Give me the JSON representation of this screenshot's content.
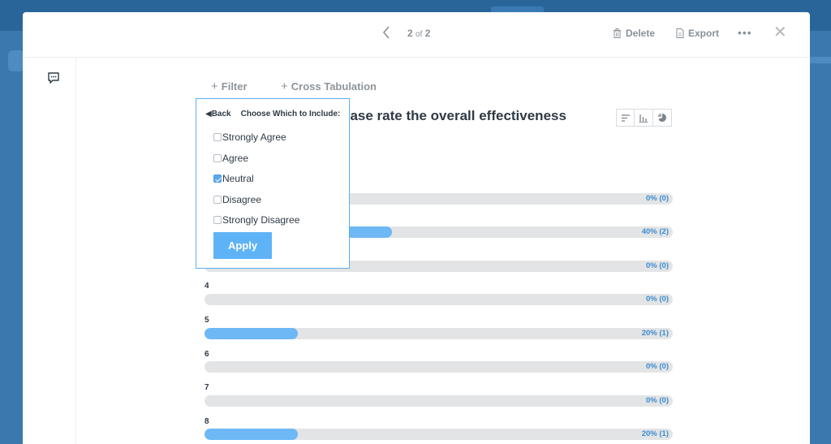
{
  "header": {
    "prev_icon": "chevron-left-icon",
    "pager_current": "2",
    "pager_of": "of",
    "pager_total": "2",
    "delete_label": "Delete",
    "export_label": "Export",
    "more_label": "•••",
    "close_label": "✕"
  },
  "toolbar": {
    "filter_label": "Filter",
    "cross_tab_label": "Cross Tabulation"
  },
  "question": {
    "title_visible_fragment": "ease rate the overall effectiveness"
  },
  "filter_panel": {
    "back_label": "◀Back",
    "heading": "Choose Which to Include:",
    "options": [
      {
        "label": "Strongly Agree",
        "checked": false
      },
      {
        "label": "Agree",
        "checked": false
      },
      {
        "label": "Neutral",
        "checked": true
      },
      {
        "label": "Disagree",
        "checked": false
      },
      {
        "label": "Strongly Disagree",
        "checked": false
      }
    ],
    "apply_label": "Apply"
  },
  "results": [
    {
      "label": "",
      "value_text": "0% (0)",
      "percent": 0
    },
    {
      "label": "",
      "value_text": "40% (2)",
      "percent": 40
    },
    {
      "label": "",
      "value_text": "0% (0)",
      "percent": 0
    },
    {
      "label": "4",
      "value_text": "0% (0)",
      "percent": 0
    },
    {
      "label": "5",
      "value_text": "20% (1)",
      "percent": 20
    },
    {
      "label": "6",
      "value_text": "0% (0)",
      "percent": 0
    },
    {
      "label": "7",
      "value_text": "0% (0)",
      "percent": 0
    },
    {
      "label": "8",
      "value_text": "20% (1)",
      "percent": 20
    }
  ],
  "colors": {
    "accent": "#5aaef0",
    "bar_fill": "#6db8f5",
    "bar_track": "#e3e4e6",
    "value_text": "#3c8ccf"
  }
}
